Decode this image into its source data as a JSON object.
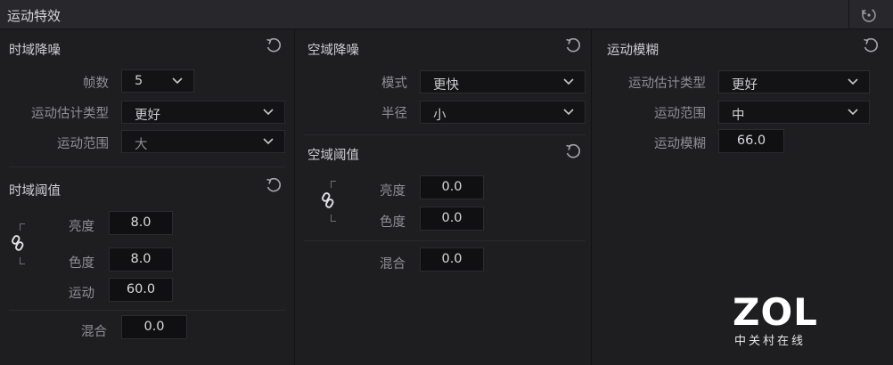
{
  "panel": {
    "title": "运动特效"
  },
  "temporal_nr": {
    "title": "时域降噪",
    "frames_label": "帧数",
    "frames_value": "5",
    "motion_est_label": "运动估计类型",
    "motion_est_value": "更好",
    "motion_range_label": "运动范围",
    "motion_range_value": "大"
  },
  "temporal_threshold": {
    "title": "时域阈值",
    "luma_label": "亮度",
    "luma_value": "8.0",
    "chroma_label": "色度",
    "chroma_value": "8.0",
    "motion_label": "运动",
    "motion_value": "60.0",
    "blend_label": "混合",
    "blend_value": "0.0"
  },
  "spatial_nr": {
    "title": "空域降噪",
    "mode_label": "模式",
    "mode_value": "更快",
    "radius_label": "半径",
    "radius_value": "小"
  },
  "spatial_threshold": {
    "title": "空域阈值",
    "luma_label": "亮度",
    "luma_value": "0.0",
    "chroma_label": "色度",
    "chroma_value": "0.0",
    "blend_label": "混合",
    "blend_value": "0.0"
  },
  "motion_blur": {
    "title": "运动模糊",
    "motion_est_label": "运动估计类型",
    "motion_est_value": "更好",
    "motion_range_label": "运动范围",
    "motion_range_value": "中",
    "motion_blur_label": "运动模糊",
    "motion_blur_value": "66.0"
  },
  "watermark": {
    "logo": "ZOL",
    "sub": "中关村在线"
  },
  "icons": {
    "reset": "reset-icon",
    "link": "link-icon",
    "chevron": "chevron-down-icon"
  }
}
